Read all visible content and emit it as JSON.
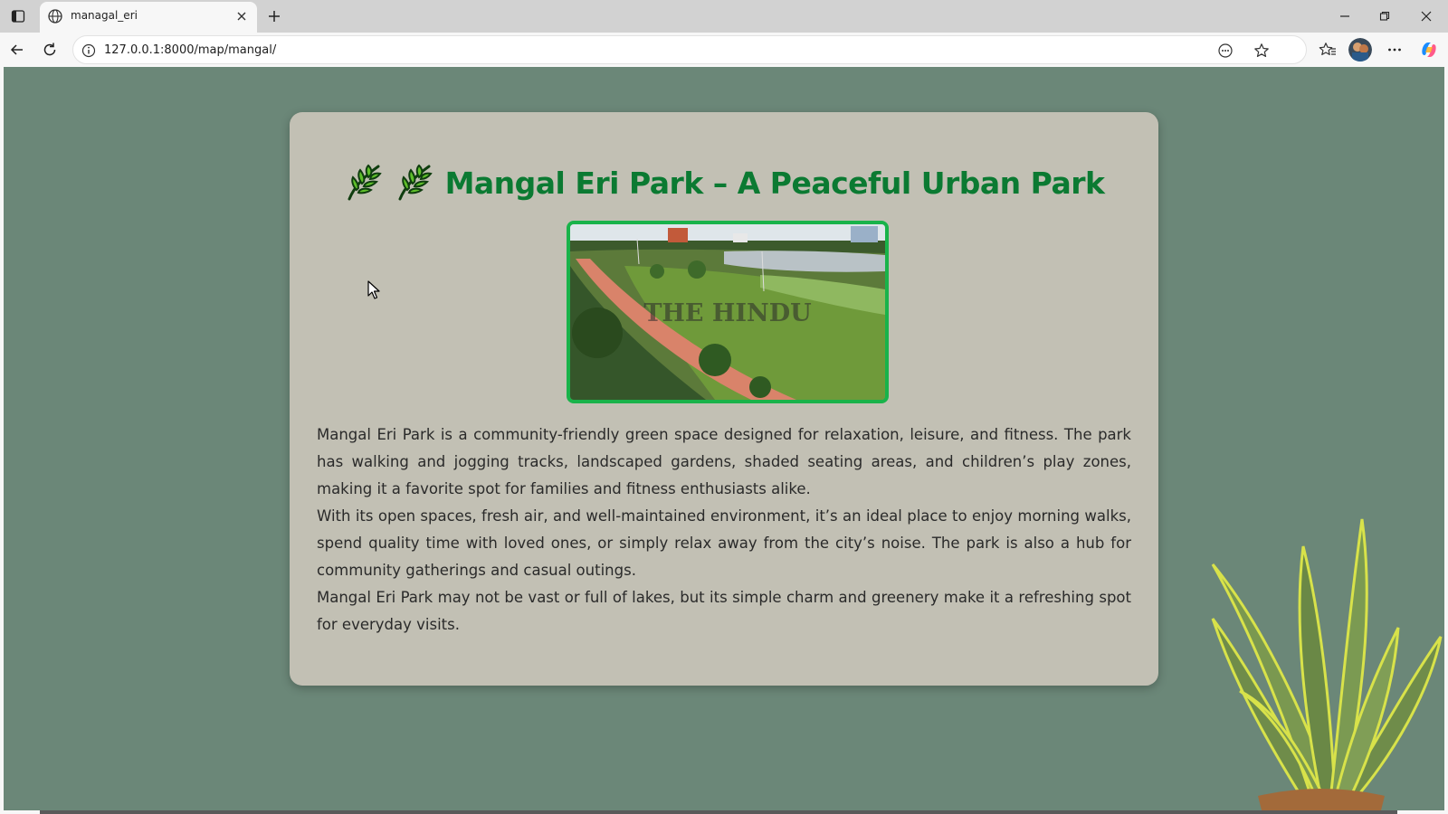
{
  "browser": {
    "tab_title": "managal_eri",
    "url": "127.0.0.1:8000/map/mangal/"
  },
  "page": {
    "title": "Mangal Eri Park – A Peaceful Urban Park",
    "title_icon": "leaf-icon",
    "image_watermark": "THE HINDU",
    "paragraphs": [
      "Mangal Eri Park is a community-friendly green space designed for relaxation, leisure, and fitness. The park has walking and jogging tracks, landscaped gardens, shaded seating areas, and children’s play zones, making it a favorite spot for families and fitness enthusiasts alike.",
      "With its open spaces, fresh air, and well-maintained environment, it’s an ideal place to enjoy morning walks, spend quality time with loved ones, or simply relax away from the city’s noise. The park is also a hub for community gatherings and casual outings.",
      "Mangal Eri Park may not be vast or full of lakes, but its simple charm and greenery make it a refreshing spot for everyday visits."
    ]
  },
  "colors": {
    "page_background": "#6b8778",
    "card_background": "#c2c0b4",
    "title_color": "#0b7a32",
    "image_border": "#19b34a"
  }
}
